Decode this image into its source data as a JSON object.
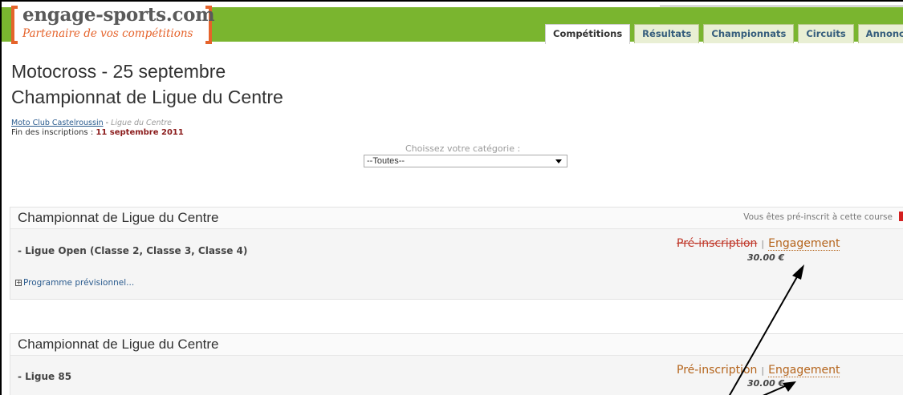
{
  "header": {
    "logo_title": "engage-sports.com",
    "logo_subtitle": "Partenaire de vos compétitions",
    "accent_color": "#7ab52f",
    "brand_color": "#e5632b"
  },
  "tabs": [
    {
      "label": "Compétitions",
      "active": true
    },
    {
      "label": "Résultats",
      "active": false
    },
    {
      "label": "Championnats",
      "active": false
    },
    {
      "label": "Circuits",
      "active": false
    },
    {
      "label": "Annonces",
      "active": false
    }
  ],
  "page": {
    "title_line1": "Motocross - 25 septembre",
    "title_line2": "Championnat de Ligue du Centre",
    "club_link": "Moto Club Castelroussin",
    "club_separator": " - ",
    "ligue": "Ligue du Centre",
    "fin_label": "Fin des inscriptions : ",
    "fin_date": "11 septembre 2011"
  },
  "category": {
    "label": "Choissez votre catégorie :",
    "selected": "--Toutes--"
  },
  "races": [
    {
      "championship": "Championnat de Ligue du Centre",
      "status_note": "Vous êtes pré-inscrit à cette course",
      "name": "- Ligue Open (Classe 2, Classe 3, Classe 4)",
      "pre_label": "Pré-inscription",
      "separator": "|",
      "eng_label": "Engagement",
      "price": "30.00 €",
      "programme": "Programme prévisionnel..."
    },
    {
      "championship": "Championnat de Ligue du Centre",
      "name": "- Ligue 85",
      "pre_label": "Pré-inscription",
      "separator": "|",
      "eng_label": "Engagement",
      "price": "30.00 €"
    }
  ]
}
